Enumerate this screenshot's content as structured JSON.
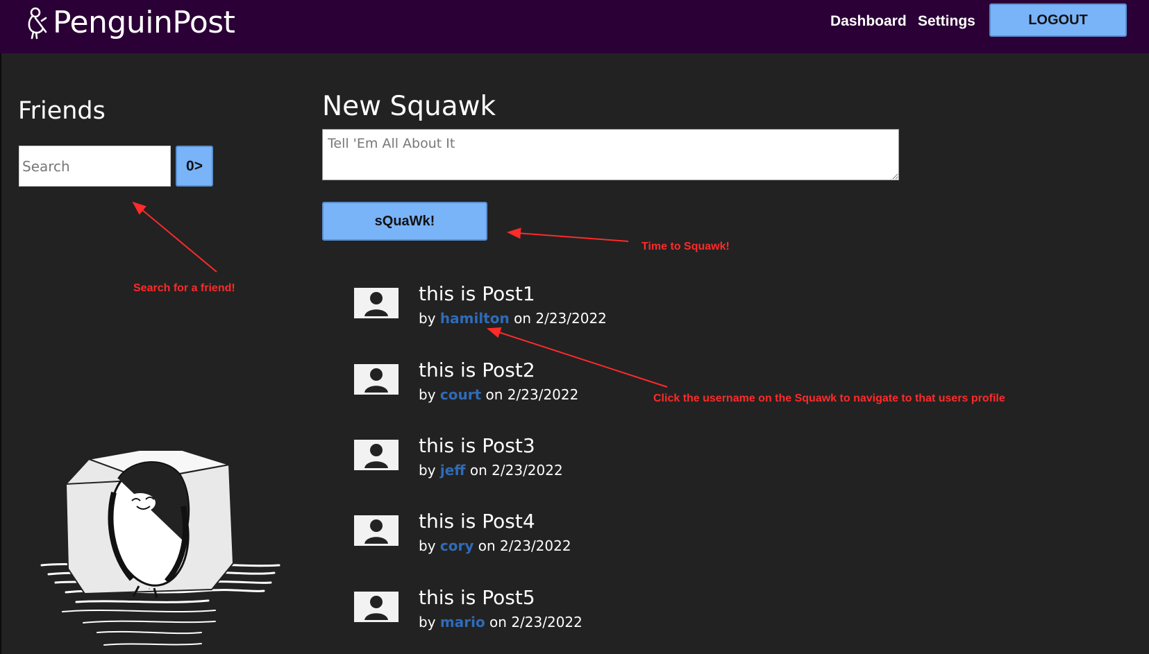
{
  "navbar": {
    "brand": "PenguinPost",
    "links": [
      "Dashboard",
      "Settings"
    ],
    "logout_label": "LOGOUT"
  },
  "friends": {
    "title": "Friends",
    "search_placeholder": "Search",
    "search_button_label": "0>"
  },
  "composer": {
    "title": "New Squawk",
    "placeholder": "Tell 'Em All About It",
    "submit_label": "sQuaWk!"
  },
  "posts": [
    {
      "title": "this is Post1",
      "by": "by",
      "user": "hamilton",
      "on": "on",
      "date": "2/23/2022"
    },
    {
      "title": "this is Post2",
      "by": "by",
      "user": "court",
      "on": "on",
      "date": "2/23/2022"
    },
    {
      "title": "this is Post3",
      "by": "by",
      "user": "jeff",
      "on": "on",
      "date": "2/23/2022"
    },
    {
      "title": "this is Post4",
      "by": "by",
      "user": "cory",
      "on": "on",
      "date": "2/23/2022"
    },
    {
      "title": "this is Post5",
      "by": "by",
      "user": "mario",
      "on": "on",
      "date": "2/23/2022"
    }
  ],
  "annotations": {
    "search": "Search for a friend!",
    "squawk": "Time to Squawk!",
    "username": "Click the username on the Squawk to navigate to that users profile"
  },
  "colors": {
    "navbar_bg": "#2b0036",
    "page_bg": "#222222",
    "button_bg": "#79b3f8",
    "username_link": "#2f6bb8",
    "annotation": "#ff2a2a"
  }
}
